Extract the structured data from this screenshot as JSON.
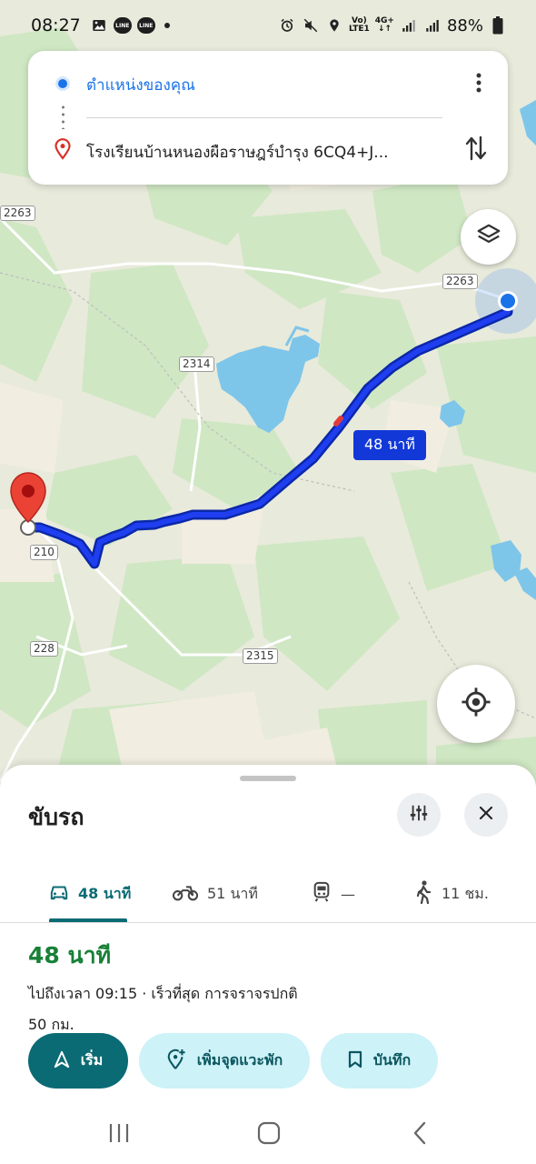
{
  "status_bar": {
    "time": "08:27",
    "network_top": "Vo)",
    "network_bottom": "LTE1",
    "network_type": "4G+",
    "battery": "88%",
    "icons": [
      "image-icon",
      "line-app-icon",
      "line-app-icon",
      "notification-dot",
      "alarm-icon",
      "mute-icon",
      "location-icon",
      "wifi-icon",
      "signal-icon",
      "signal-icon",
      "battery-icon"
    ]
  },
  "directions": {
    "origin": "ตำแหน่งของคุณ",
    "destination": "โรงเรียนบ้านหนองผือราษฎร์บำรุง 6CQ4+J...",
    "origin_color": "#1a73e8",
    "destination_pin_color": "#d93025"
  },
  "map": {
    "road_labels": [
      "2263",
      "2263",
      "2314",
      "210",
      "228",
      "2315"
    ],
    "route_duration": "48 นาที",
    "route_color": "#1238d8"
  },
  "sheet": {
    "title": "ขับรถ",
    "tabs": [
      {
        "label": "48 นาที",
        "icon": "car-icon"
      },
      {
        "label": "51 นาที",
        "icon": "motorcycle-icon"
      },
      {
        "label": "—",
        "icon": "train-icon"
      },
      {
        "label": "11 ชม.",
        "icon": "walk-icon"
      }
    ],
    "duration": "48 นาที",
    "arrival": "ไปถึงเวลา 09:15 · เร็วที่สุด การจราจรปกติ",
    "distance": "50 กม.",
    "buttons": {
      "start": "เริ่ม",
      "add_stop": "เพิ่มจุดแวะพัก",
      "save": "บันทึก"
    },
    "accent": "#0b6b74",
    "duration_color": "#188038"
  }
}
